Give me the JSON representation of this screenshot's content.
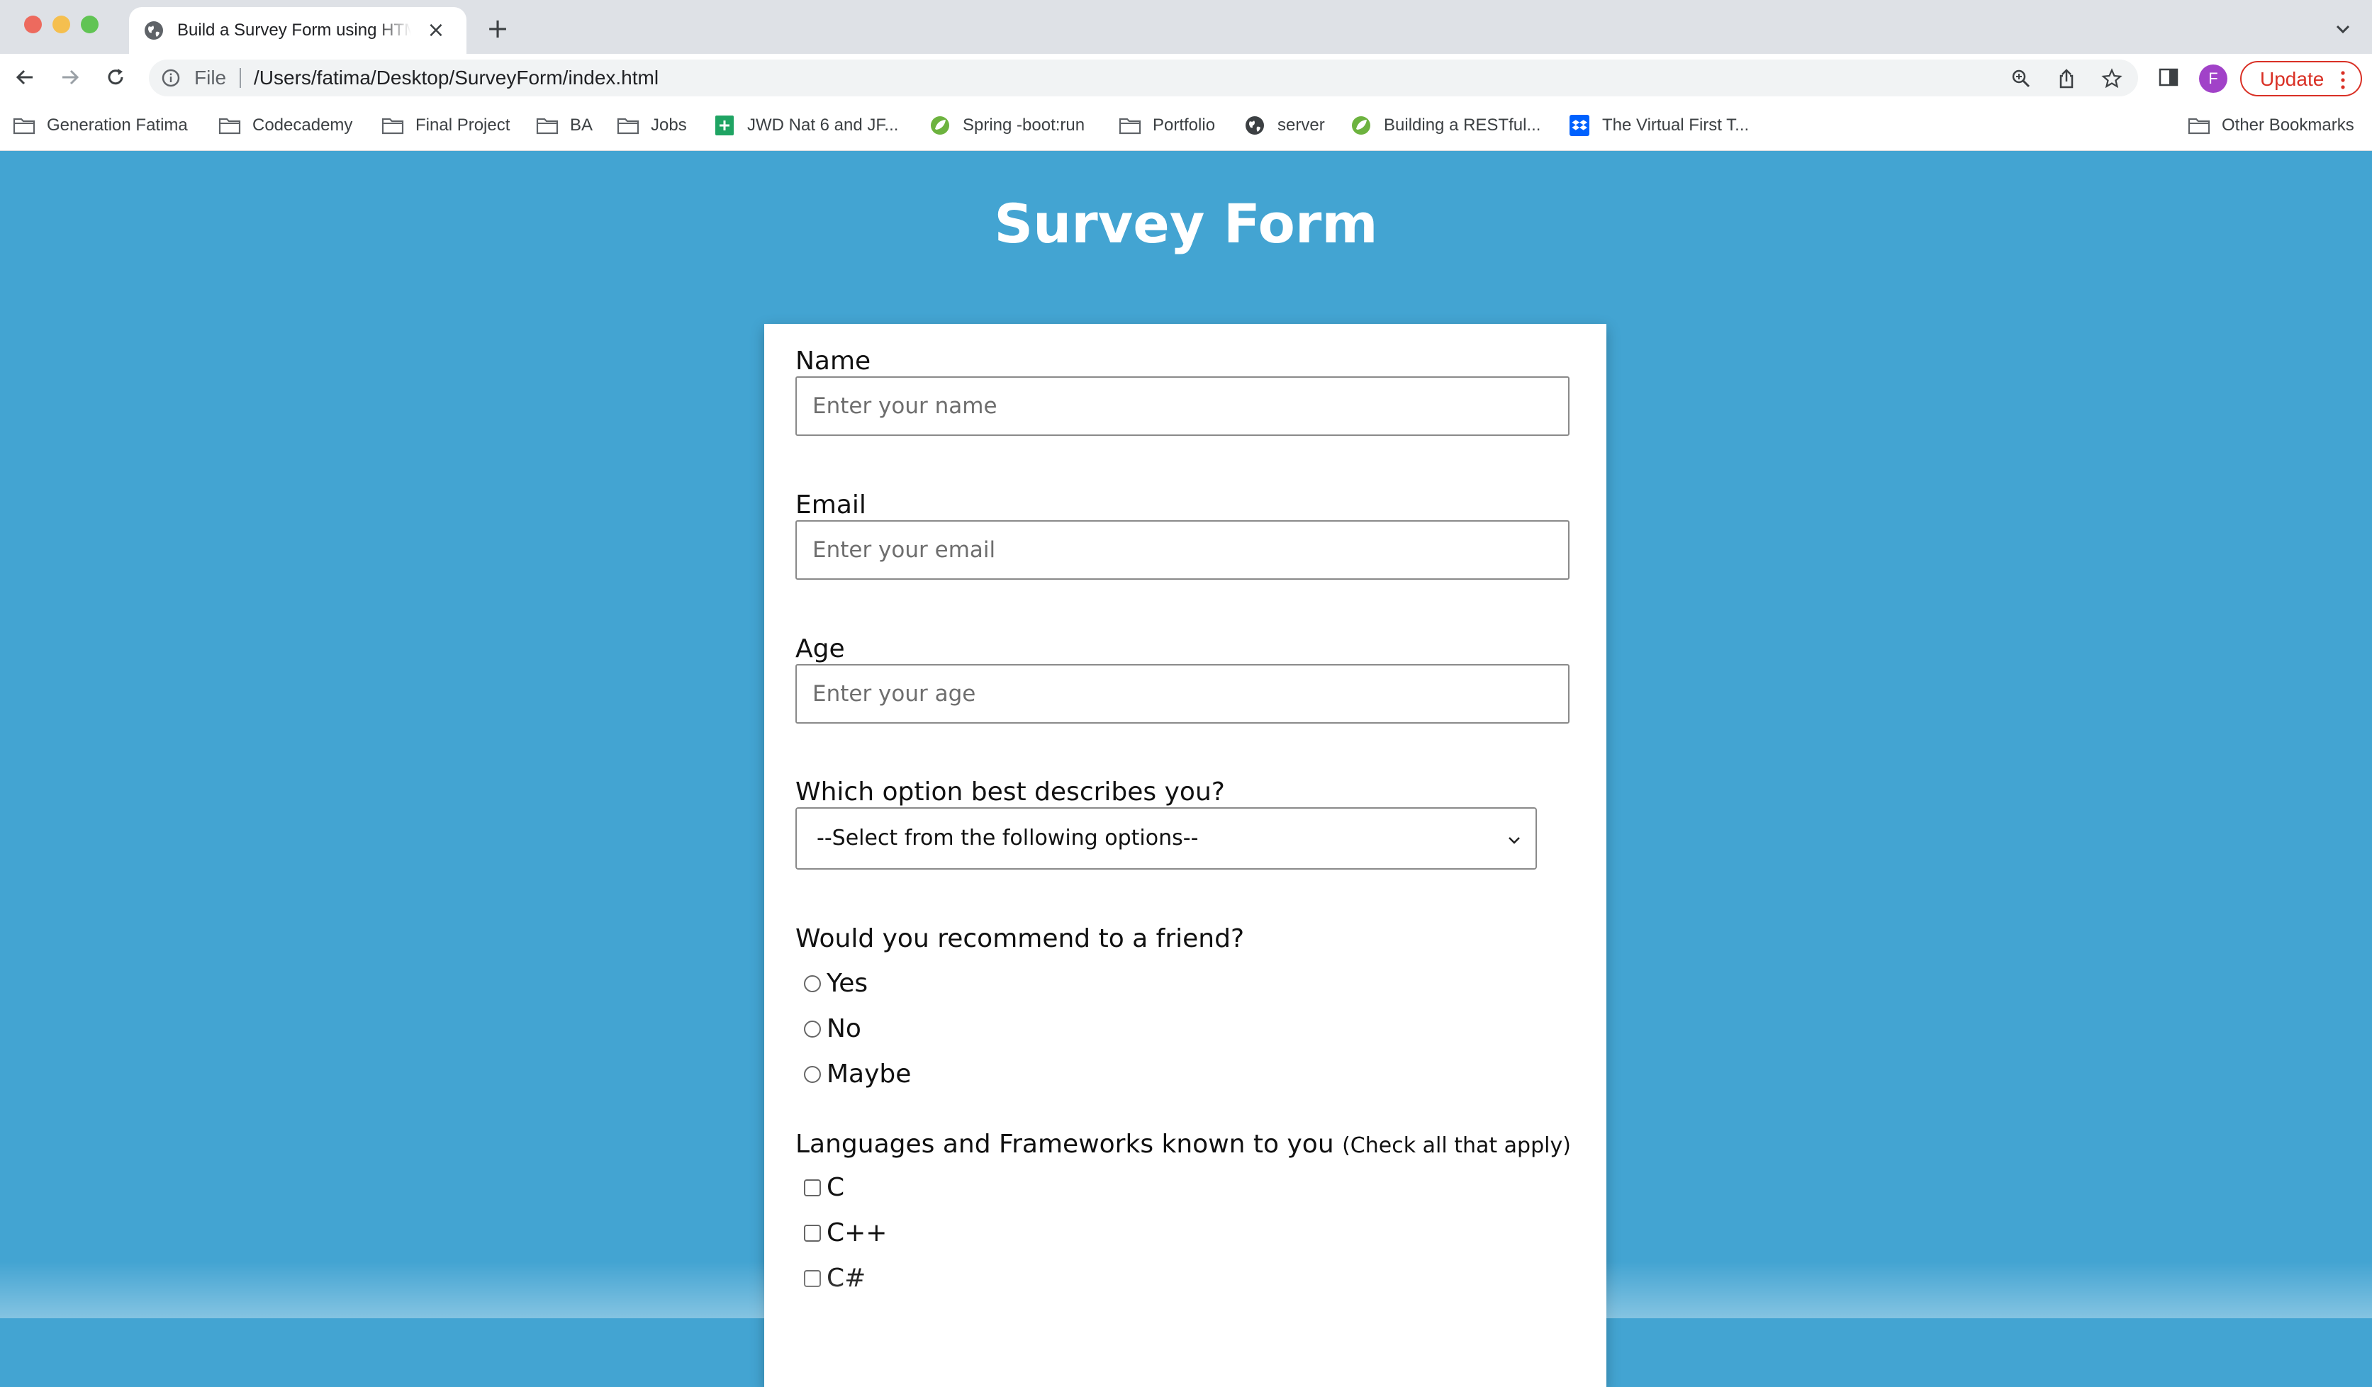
{
  "browser": {
    "tab_title": "Build a Survey Form using HTML",
    "new_tab_symbol": "+",
    "close_symbol": "×",
    "file_label": "File",
    "url": "/Users/fatima/Desktop/SurveyForm/index.html",
    "profile_initial": "F",
    "update_label": "Update",
    "bookmarks": [
      {
        "label": "Generation Fatima",
        "icon": "folder-icon"
      },
      {
        "label": "Codecademy",
        "icon": "folder-icon"
      },
      {
        "label": "Final Project",
        "icon": "folder-icon"
      },
      {
        "label": "BA",
        "icon": "folder-icon"
      },
      {
        "label": "Jobs",
        "icon": "folder-icon"
      },
      {
        "label": "JWD Nat 6 and JF...",
        "icon": "sheets-icon"
      },
      {
        "label": "Spring -boot:run",
        "icon": "spring-icon"
      },
      {
        "label": "Portfolio",
        "icon": "folder-icon"
      },
      {
        "label": "server",
        "icon": "globe-icon"
      },
      {
        "label": "Building a RESTful...",
        "icon": "spring-icon"
      },
      {
        "label": "The Virtual First T...",
        "icon": "dropbox-icon"
      }
    ],
    "other_bookmarks": "Other Bookmarks"
  },
  "page": {
    "title": "Survey Form",
    "background_color": "#43a4d2"
  },
  "form": {
    "name_label": "Name",
    "name_placeholder": "Enter your name",
    "email_label": "Email",
    "email_placeholder": "Enter your email",
    "age_label": "Age",
    "age_placeholder": "Enter your age",
    "role_label": "Which option best describes you?",
    "role_selected": "--Select from the following options--",
    "recommend_label": "Would you recommend to a friend?",
    "recommend_options": [
      "Yes",
      "No",
      "Maybe"
    ],
    "languages_label": "Languages and Frameworks known to you",
    "languages_hint": "(Check all that apply)",
    "languages_options": [
      "C",
      "C++",
      "C#"
    ]
  }
}
